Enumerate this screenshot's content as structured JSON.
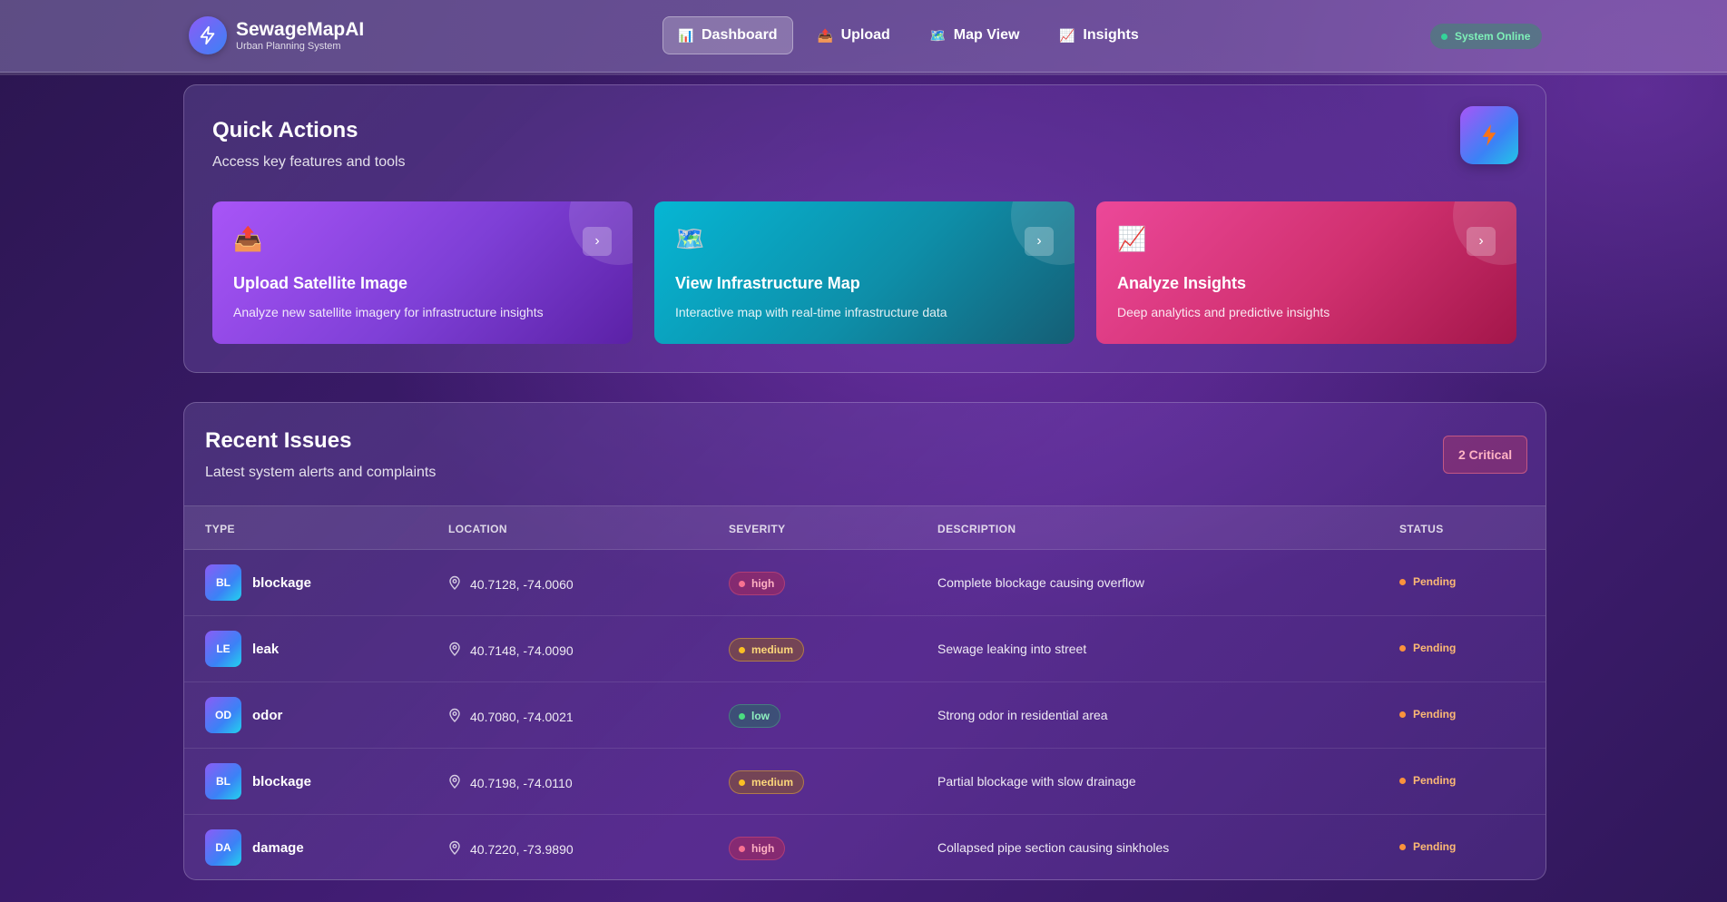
{
  "header": {
    "brand_title": "SewageMapAI",
    "brand_subtitle": "Urban Planning System",
    "nav": [
      {
        "label": "Dashboard",
        "icon": "chart-icon"
      },
      {
        "label": "Upload",
        "icon": "upload-icon"
      },
      {
        "label": "Map View",
        "icon": "map-icon"
      },
      {
        "label": "Insights",
        "icon": "insights-icon"
      }
    ],
    "status": "System Online"
  },
  "quick_actions": {
    "title": "Quick Actions",
    "subtitle": "Access key features and tools",
    "cards": [
      {
        "title": "Upload Satellite Image",
        "desc": "Analyze new satellite imagery for infrastructure insights",
        "icon": "📤"
      },
      {
        "title": "View Infrastructure Map",
        "desc": "Interactive map with real-time infrastructure data",
        "icon": "🗺️"
      },
      {
        "title": "Analyze Insights",
        "desc": "Deep analytics and predictive insights",
        "icon": "📈"
      }
    ]
  },
  "issues": {
    "title": "Recent Issues",
    "subtitle": "Latest system alerts and complaints",
    "critical_badge": "2 Critical",
    "columns": [
      "TYPE",
      "LOCATION",
      "SEVERITY",
      "DESCRIPTION",
      "STATUS"
    ],
    "rows": [
      {
        "abbr": "BL",
        "type": "blockage",
        "location": "40.7128, -74.0060",
        "severity": "high",
        "description": "Complete blockage causing overflow",
        "status": "Pending"
      },
      {
        "abbr": "LE",
        "type": "leak",
        "location": "40.7148, -74.0090",
        "severity": "medium",
        "description": "Sewage leaking into street",
        "status": "Pending"
      },
      {
        "abbr": "OD",
        "type": "odor",
        "location": "40.7080, -74.0021",
        "severity": "low",
        "description": "Strong odor in residential area",
        "status": "Pending"
      },
      {
        "abbr": "BL",
        "type": "blockage",
        "location": "40.7198, -74.0110",
        "severity": "medium",
        "description": "Partial blockage with slow drainage",
        "status": "Pending"
      },
      {
        "abbr": "DA",
        "type": "damage",
        "location": "40.7220, -73.9890",
        "severity": "high",
        "description": "Collapsed pipe section causing sinkholes",
        "status": "Pending"
      }
    ]
  },
  "colors": {
    "high": "#f87191",
    "medium": "#fbbf24",
    "low": "#4ade80",
    "pending": "#fb923c",
    "online": "#34d399"
  }
}
